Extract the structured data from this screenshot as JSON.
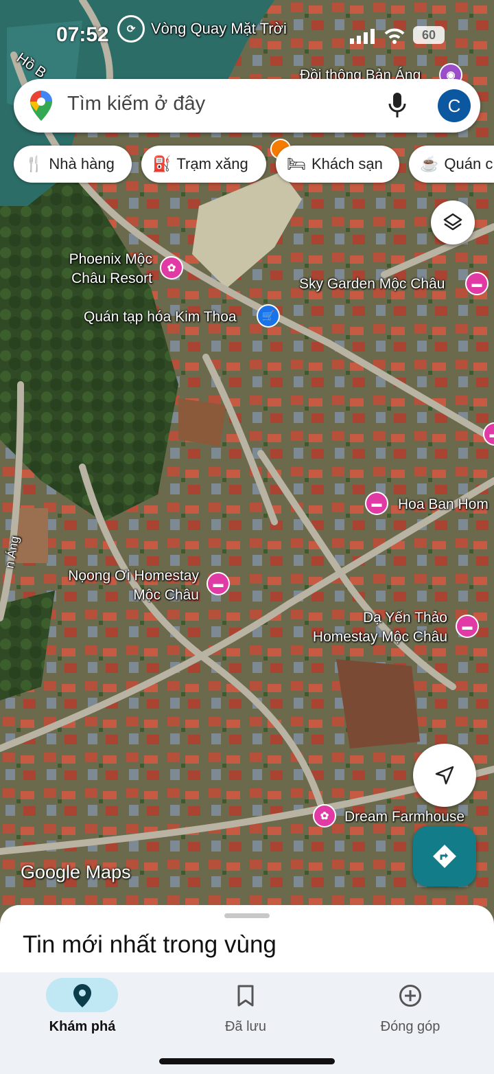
{
  "status": {
    "time": "07:52",
    "battery": "60"
  },
  "search": {
    "placeholder": "Tìm kiếm ở đây",
    "avatar_letter": "C"
  },
  "chips": [
    {
      "label": "Nhà hàng",
      "icon": "fork-knife-icon"
    },
    {
      "label": "Trạm xăng",
      "icon": "fuel-icon"
    },
    {
      "label": "Khách sạn",
      "icon": "bed-icon"
    },
    {
      "label": "Quán c",
      "icon": "coffee-icon"
    }
  ],
  "map_labels": {
    "vong_quay": "Vòng Quay Mặt Trời",
    "doi_thong": "Đồi thông Bản Áng",
    "ho": "Hồ B",
    "phoenix_1": "Phoenix Mộc",
    "phoenix_2": "Châu Resort",
    "sky_garden": "Sky Garden Mộc Châu",
    "kim_thoa": "Quán tạp hóa Kim Thoa",
    "hoa_ban": "Hoa Ban Hom",
    "nong_oi_1": "Nọong Ơi Homestay",
    "nong_oi_2": "Mộc Châu",
    "da_yen_1": "Dạ Yến Thảo",
    "da_yen_2": "Homestay Mộc Châu",
    "dream": "Dream Farmhouse",
    "ban_ang_road": "n Áng"
  },
  "map_logo": "Google Maps",
  "sheet": {
    "title": "Tin mới nhất trong vùng"
  },
  "nav": [
    {
      "label": "Khám phá",
      "icon": "explore-pin-icon",
      "active": true
    },
    {
      "label": "Đã lưu",
      "icon": "bookmark-icon",
      "active": false
    },
    {
      "label": "Đóng góp",
      "icon": "add-circle-icon",
      "active": false
    }
  ]
}
